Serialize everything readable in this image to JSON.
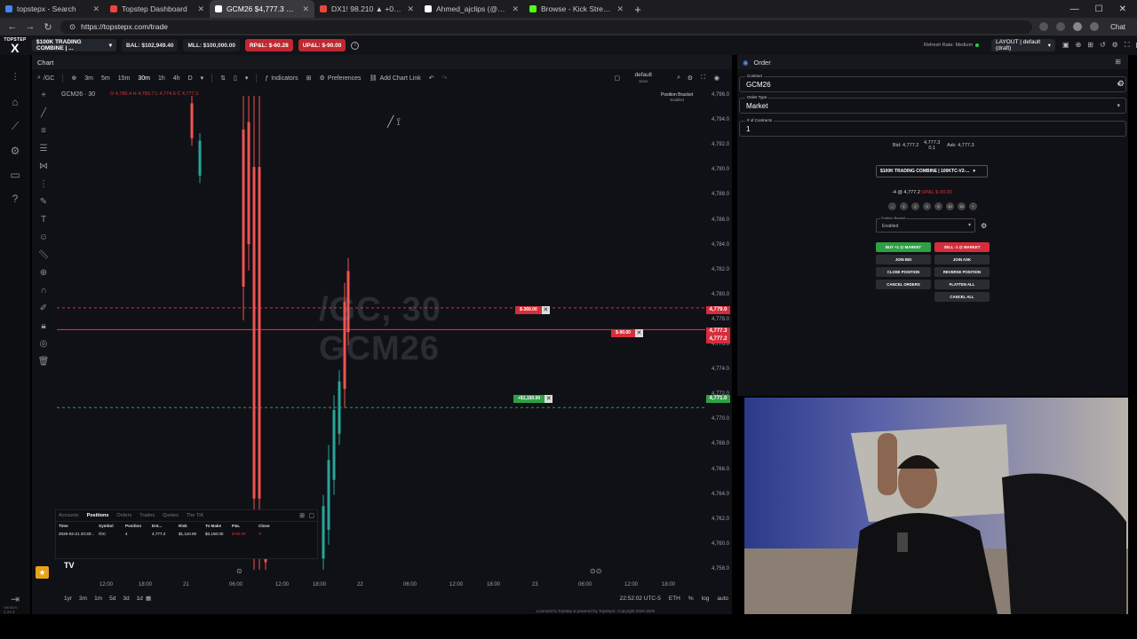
{
  "browser": {
    "tabs": [
      {
        "title": "topstepx - Search",
        "color": "#4285f4",
        "active": false
      },
      {
        "title": "Topstep Dashboard",
        "color": "#e8453c",
        "active": false
      },
      {
        "title": "GCM26 $4,777.3 ▲ 1.22%",
        "color": "#ffffff",
        "active": true
      },
      {
        "title": "DX1! 98.210 ▲ +0.03% Unnamed",
        "color": "#e8453c",
        "active": false
      },
      {
        "title": "Ahmed_ajclips (@ahmed.ajclips1)",
        "color": "#ffffff",
        "active": false
      },
      {
        "title": "Browse - Kick Streaming",
        "color": "#53fc18",
        "active": false
      }
    ],
    "url": "https://topstepx.com/trade",
    "chat_label": "Chat"
  },
  "appbar": {
    "logo_line1": "TOPSTEP",
    "logo_line2": "X",
    "account": "$100K TRADING COMBINE | ...",
    "bal": "BAL: $102,949.40",
    "mll": "MLL: $100,000.00",
    "rpnl": "RP&L: $-60.28",
    "upnl": "UP&L: $-90.00",
    "refresh": "Refresh Rate: Medium",
    "layout": "LAYOUT | default (draft)"
  },
  "chart": {
    "panel_title": "Chart",
    "symbol_search": "/GC",
    "timeframes": [
      "3m",
      "5m",
      "15m",
      "30m",
      "1h",
      "4h",
      "D"
    ],
    "indicators_label": "Indicators",
    "preferences_label": "Preferences",
    "add_chart_link_label": "Add Chart Link",
    "layout_name": "default",
    "layout_sub": "Save",
    "symbol_title": "GCM26 · 30",
    "ohlc": "O 4,780.4  H 4,783.7  L 4,774.6  C 4,777.3",
    "position_bracket": "Position Bracket",
    "position_bracket_status": "Enabled",
    "watermark_line1": "/GC, 30",
    "watermark_line2": "GCM26",
    "price_ticks": [
      "4,796.0",
      "4,794.0",
      "4,792.0",
      "4,790.0",
      "4,788.0",
      "4,786.0",
      "4,784.0",
      "4,782.0",
      "4,780.0",
      "4,778.0",
      "4,776.0",
      "4,774.0",
      "4,772.0",
      "4,770.0",
      "4,768.0",
      "4,766.0",
      "4,764.0",
      "4,762.0",
      "4,760.0",
      "4,758.0"
    ],
    "label_sl": "4,779.0",
    "label_last": "4,777.3",
    "label_last2": "4,777.2",
    "label_tp": "4,771.0",
    "order_sl": "$-360.00",
    "order_pos": "$-90.00",
    "order_tp": "+$1,150.00",
    "time_ticks": [
      "12:00",
      "18:00",
      "21",
      "06:00",
      "12:00",
      "18:00",
      "22",
      "06:00",
      "12:00",
      "18:00",
      "23",
      "06:00",
      "12:00",
      "18:00"
    ],
    "ranges": [
      "1yr",
      "3m",
      "1m",
      "5d",
      "3d",
      "1d"
    ],
    "clock": "22:52:02 UTC-5",
    "session": "ETH",
    "scale_log": "log",
    "scale_auto": "auto",
    "footer": "Licensed to Topstep & powered by TopstepX. Copyright 2024-2026"
  },
  "positions_panel": {
    "tabs": [
      "Accounts",
      "Positions",
      "Orders",
      "Trades",
      "Quotes",
      "The TIK"
    ],
    "active_tab": "Positions",
    "headers": [
      "Time",
      "Symbol",
      "Position",
      "Ent...",
      "Risk",
      "To Make",
      "P&L",
      "Close"
    ],
    "row": [
      "2026-04-21 20:30:..",
      "/GC",
      "4",
      "4,777.2",
      "$1,110.00",
      "$3,150.00",
      "$-90.00",
      "✕"
    ]
  },
  "order": {
    "panel_title": "Order",
    "contract_label": "Contract",
    "contract": "GCM26",
    "order_type_label": "Order Type",
    "order_type": "Market",
    "contracts_label": "# of Contracts",
    "contracts": "1",
    "bid": "Bid: 4,777.2",
    "last": "4,777.3",
    "spread": "0.1",
    "ask": "Ask: 4,777.3",
    "account": "$100K TRADING COMBINE | 100KTC-V2-...",
    "position": "-4 @ 4,777.2",
    "position_pnl": "UP&L $-90.00",
    "qty_presets": [
      "1",
      "2",
      "3",
      "5",
      "10",
      "15"
    ],
    "bracket_label": "Position Bracket",
    "bracket_value": "Enabled",
    "buttons": {
      "buy": "BUY +1 @ MARKET",
      "sell": "SELL -1 @ MARKET",
      "join_bid": "JOIN BID",
      "join_ask": "JOIN ASK",
      "close": "CLOSE POSITION",
      "reverse": "REVERSE POSITION",
      "cancel_orders": "CANCEL ORDERS",
      "flatten": "FLATTEN ALL",
      "cancel_all": "CANCEL ALL"
    }
  },
  "app_version": "Version: 1.24.3",
  "colors": {
    "up": "#26a69a",
    "down": "#ef5350",
    "buy": "#2ea043",
    "sell": "#d62d3a",
    "accent": "#c0282f"
  }
}
